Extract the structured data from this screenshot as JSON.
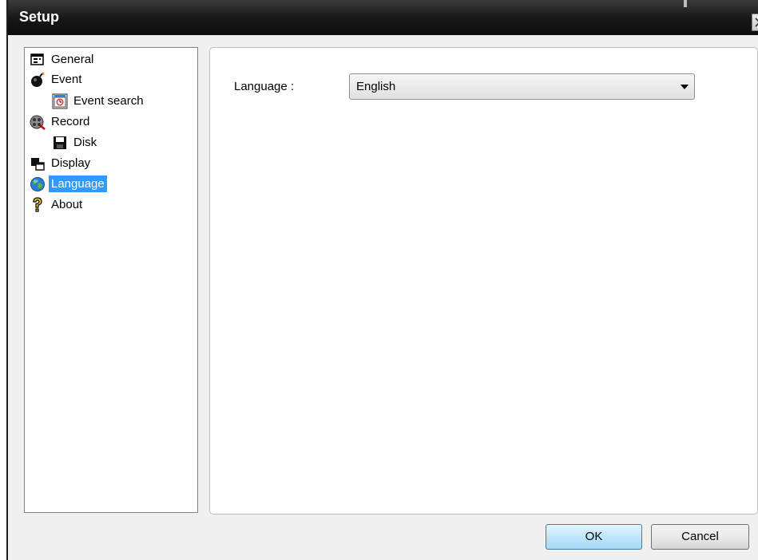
{
  "window": {
    "title": "Setup"
  },
  "tree": {
    "items": [
      {
        "label": "General",
        "icon": "general-icon",
        "level": 0,
        "selected": false
      },
      {
        "label": "Event",
        "icon": "event-bomb-icon",
        "level": 0,
        "selected": false
      },
      {
        "label": "Event search",
        "icon": "event-search-icon",
        "level": 1,
        "selected": false
      },
      {
        "label": "Record",
        "icon": "record-icon",
        "level": 0,
        "selected": false
      },
      {
        "label": "Disk",
        "icon": "disk-icon",
        "level": 1,
        "selected": false
      },
      {
        "label": "Display",
        "icon": "display-icon",
        "level": 0,
        "selected": false
      },
      {
        "label": "Language",
        "icon": "globe-icon",
        "level": 0,
        "selected": true
      },
      {
        "label": "About",
        "icon": "question-icon",
        "level": 0,
        "selected": false
      }
    ]
  },
  "language": {
    "label": "Language :",
    "selected": "English"
  },
  "buttons": {
    "ok": "OK",
    "cancel": "Cancel"
  },
  "colors": {
    "selection": "#3399ff",
    "title_bar": "#161616",
    "dialog_bg": "#f0f0f0"
  }
}
